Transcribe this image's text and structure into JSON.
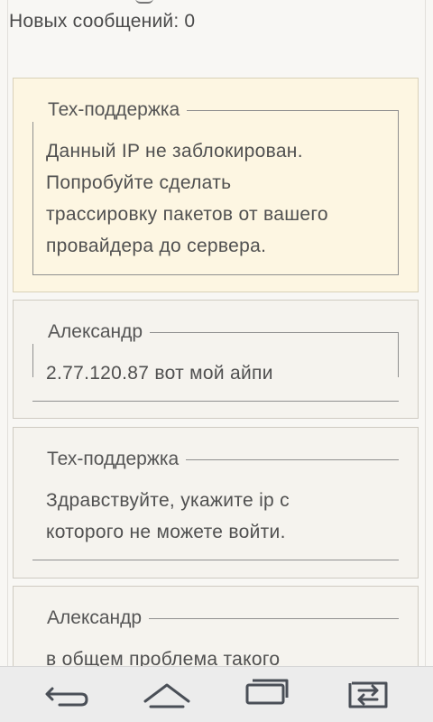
{
  "header": {
    "new_messages_label": "Новых сообщений: 0"
  },
  "messages": [
    {
      "author": "Тех-поддержка",
      "text_lines": [
        "Данный IP не заблокирован.",
        "Попробуйте сделать",
        "трассировку пакетов от вашего",
        "провайдера до сервера."
      ],
      "highlight": true
    },
    {
      "author": "Александр",
      "text_lines": [
        "2.77.120.87 вот мой айпи"
      ],
      "highlight": false
    },
    {
      "author": "Тех-поддержка",
      "text_lines": [
        "Здравствуйте, укажите ip с",
        "которого не можете войти."
      ],
      "highlight": false
    },
    {
      "author": "Александр",
      "text_lines": [
        "в общем проблема такого"
      ],
      "highlight": false
    }
  ],
  "navbar": {
    "icons": [
      "back-icon",
      "home-icon",
      "recent-apps-icon",
      "switch-icon"
    ]
  },
  "colors": {
    "highlight_bg": "#fdf6e2",
    "card_bg": "#f5f3ee",
    "navbar_bg": "#ececec",
    "icon": "#4a4f57"
  }
}
